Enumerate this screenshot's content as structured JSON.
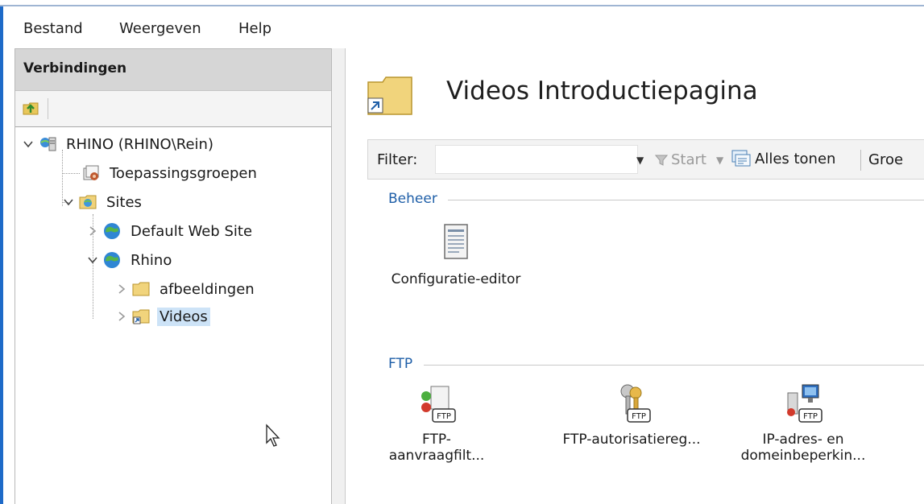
{
  "menu": {
    "items": [
      "Bestand",
      "Weergeven",
      "Help"
    ]
  },
  "connections": {
    "header": "Verbindingen",
    "tree": [
      {
        "label": "RHINO (RHINO\\Rein)",
        "icon": "server-icon"
      },
      {
        "label": "Toepassingsgroepen",
        "icon": "app-pools-icon"
      },
      {
        "label": "Sites",
        "icon": "sites-folder-icon"
      },
      {
        "label": "Default Web Site",
        "icon": "globe-icon"
      },
      {
        "label": "Rhino",
        "icon": "globe-icon"
      },
      {
        "label": "afbeeldingen",
        "icon": "folder-icon"
      },
      {
        "label": "Videos",
        "icon": "virtual-folder-icon"
      }
    ]
  },
  "main": {
    "title": "Videos Introductiepagina",
    "filter": {
      "label": "Filter:",
      "value": "",
      "start_label": "Start",
      "show_all_label": "Alles tonen",
      "group_label": "Groe"
    },
    "sections": [
      {
        "name": "Beheer",
        "features": [
          {
            "label": "Configuratie-editor",
            "icon": "configuration-editor-icon"
          }
        ]
      },
      {
        "name": "FTP",
        "features": [
          {
            "label": "FTP-aanvraagfilt...",
            "icon": "ftp-request-filtering-icon"
          },
          {
            "label": "FTP-autorisatiereg...",
            "icon": "ftp-authorization-icon"
          },
          {
            "label_line1": "IP-adres- en",
            "label_line2": "domeinbeperkin...",
            "icon": "ip-domain-restrictions-icon"
          }
        ]
      }
    ],
    "ftp_badge": "FTP"
  },
  "colors": {
    "accent": "#1e6ac8",
    "section_heading": "#1f5fa8",
    "selected_bg": "#cde3f7",
    "panel_header_bg": "#d6d6d6"
  }
}
